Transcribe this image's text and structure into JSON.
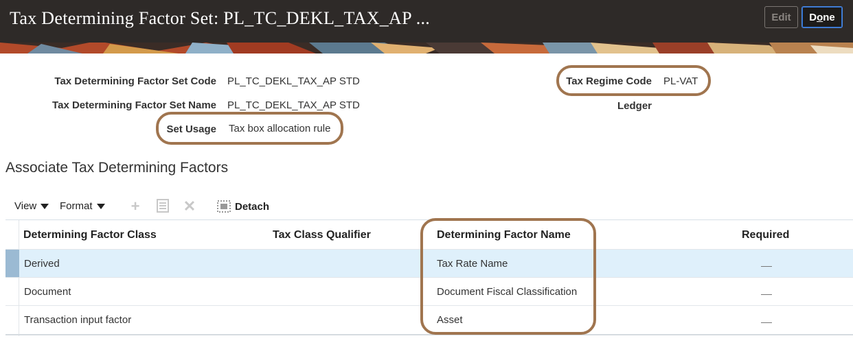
{
  "header": {
    "title": "Tax Determining Factor Set: PL_TC_DEKL_TAX_AP ...",
    "edit_label": "Edit",
    "done_prefix": "D",
    "done_underlined": "o",
    "done_suffix": "ne"
  },
  "form": {
    "set_code_label": "Tax Determining Factor Set Code",
    "set_code_value": "PL_TC_DEKL_TAX_AP STD",
    "set_name_label": "Tax Determining Factor Set Name",
    "set_name_value": "PL_TC_DEKL_TAX_AP STD",
    "set_usage_label": "Set Usage",
    "set_usage_value": "Tax box allocation rule",
    "regime_label": "Tax Regime Code",
    "regime_value": "PL-VAT",
    "ledger_label": "Ledger"
  },
  "section": {
    "title": "Associate Tax Determining Factors"
  },
  "toolbar": {
    "view_label": "View",
    "format_label": "Format",
    "detach_label": "Detach"
  },
  "table": {
    "columns": [
      "Determining Factor Class",
      "Tax Class Qualifier",
      "Determining Factor Name",
      "Required"
    ],
    "rows": [
      {
        "class": "Derived",
        "qualifier": "",
        "name": "Tax Rate Name",
        "required": "—"
      },
      {
        "class": "Document",
        "qualifier": "",
        "name": "Document Fiscal Classification",
        "required": "—"
      },
      {
        "class": "Transaction input factor",
        "qualifier": "",
        "name": "Asset",
        "required": "—"
      }
    ]
  },
  "colors": {
    "highlight": "#a0754f",
    "selected_row": "#dff0fb",
    "header_bg": "#2e2a28"
  }
}
